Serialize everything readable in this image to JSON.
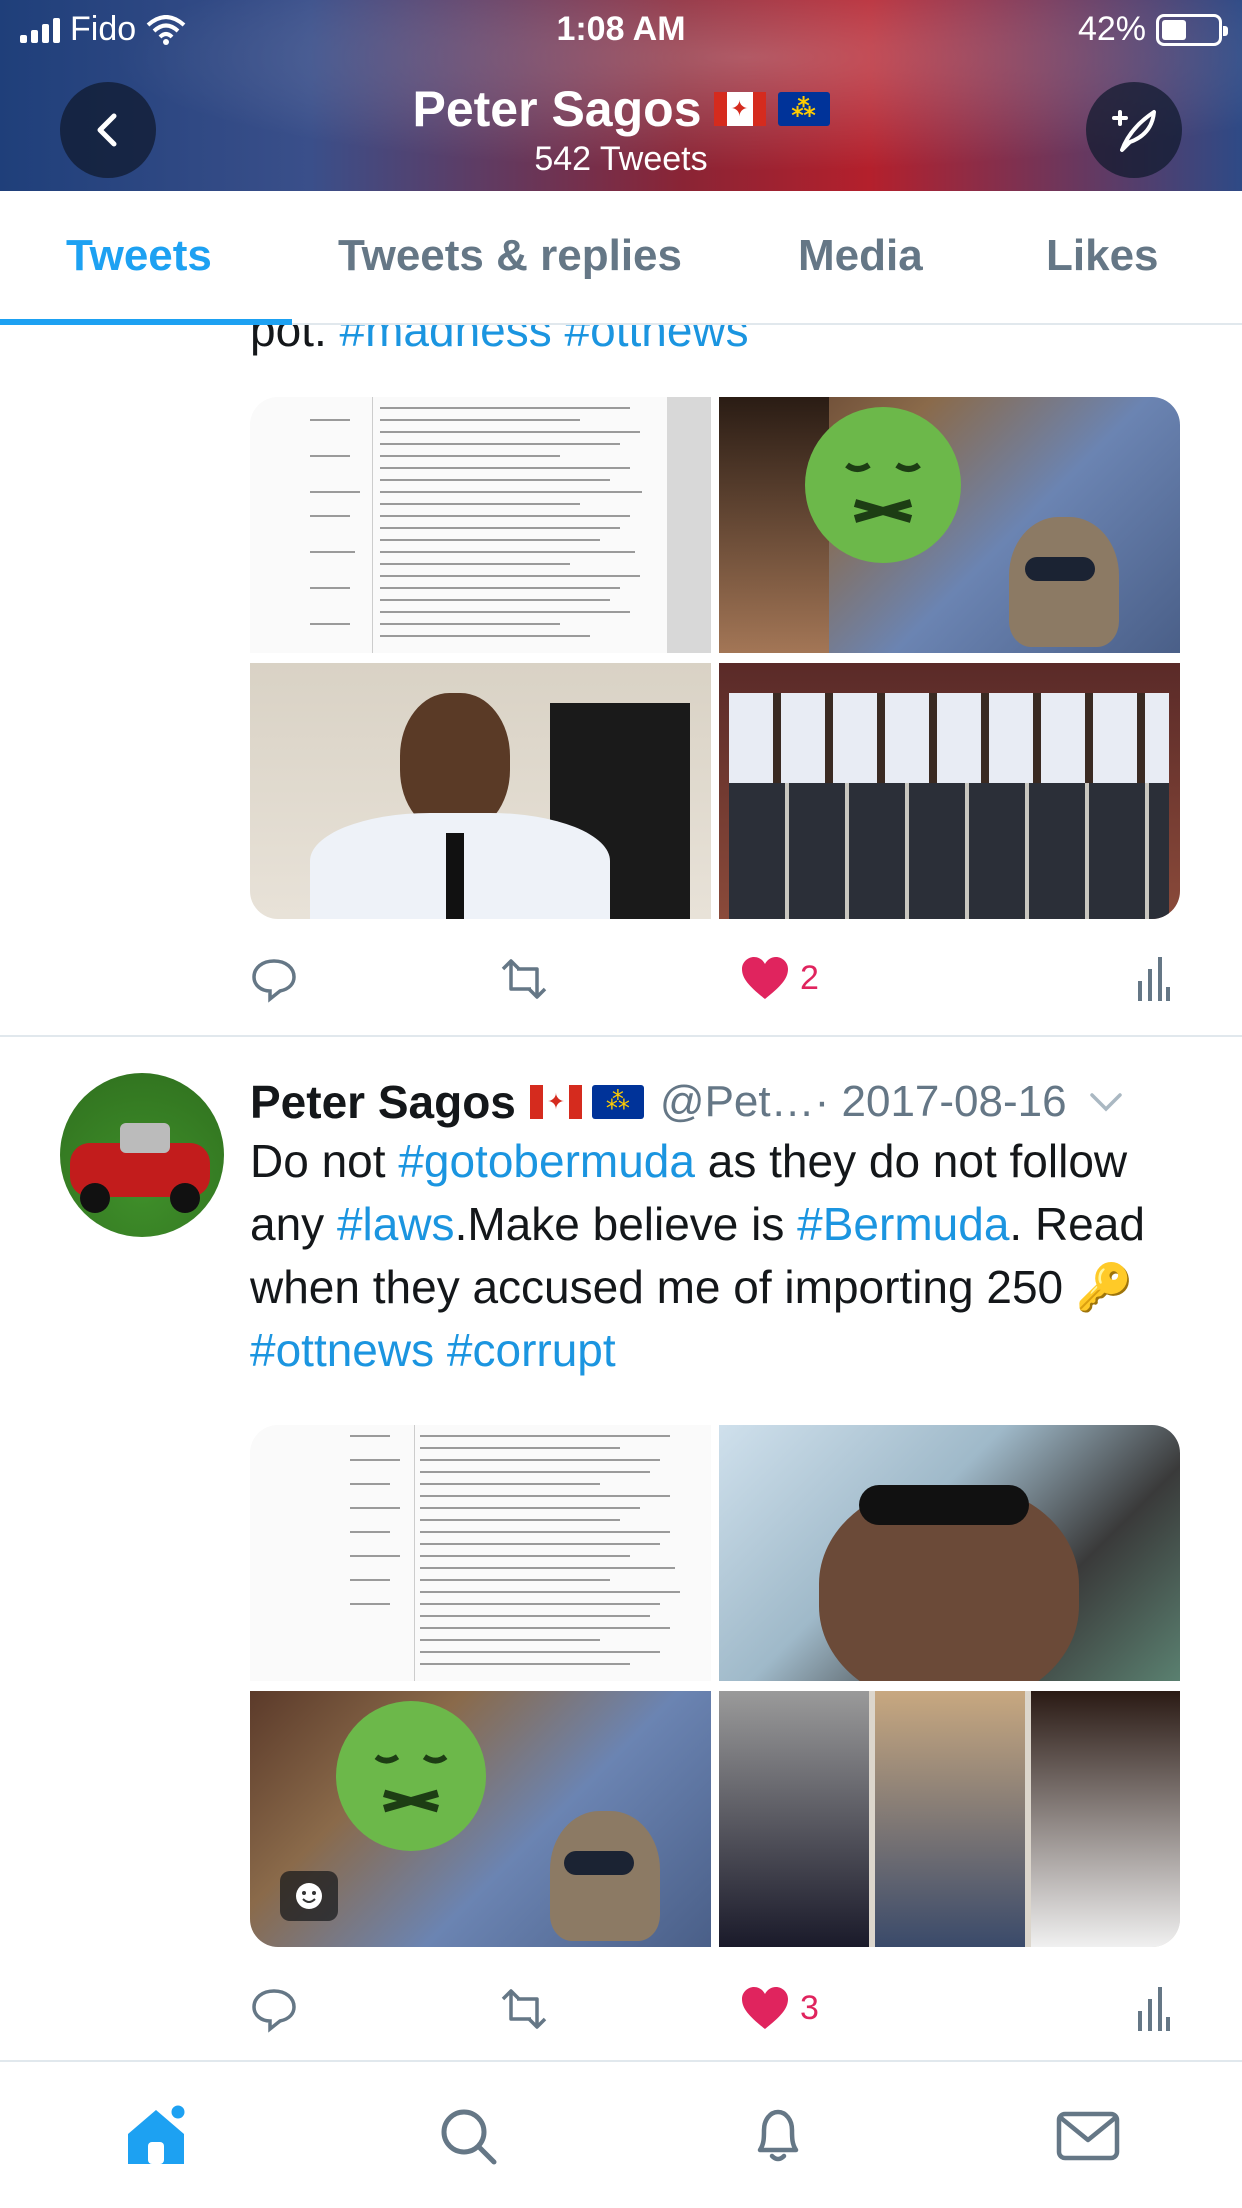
{
  "status_bar": {
    "carrier": "Fido",
    "time": "1:08 AM",
    "battery": "42%"
  },
  "header": {
    "name": "Peter Sagos",
    "tweet_count": "542 Tweets"
  },
  "tabs": [
    {
      "label": "Tweets",
      "active": true
    },
    {
      "label": "Tweets & replies",
      "active": false
    },
    {
      "label": "Media",
      "active": false
    },
    {
      "label": "Likes",
      "active": false
    }
  ],
  "tweet1": {
    "cut_text_prefix": "pot. ",
    "cut_tag1": "#madness",
    "cut_tag2": "#ottnews",
    "likes": "2"
  },
  "tweet2": {
    "name": "Peter Sagos",
    "handle": "@Pet…",
    "date": "· 2017-08-16",
    "body_1": "Do not ",
    "tag_1": "#gotobermuda",
    "body_2": " as they do not follow any ",
    "tag_2": "#laws",
    "body_3": ".Make believe is ",
    "tag_3": "#Bermuda",
    "body_4": ". Read when they accused me of importing 250 ",
    "key_emoji": "🔑",
    "tag_4": "#ottnews",
    "tag_5": "#corrupt",
    "likes": "3"
  },
  "colors": {
    "accent": "#1da1f2",
    "like": "#e0245e",
    "muted": "#657786"
  },
  "bottom_nav": [
    "home-icon",
    "search-icon",
    "notifications-icon",
    "messages-icon"
  ]
}
